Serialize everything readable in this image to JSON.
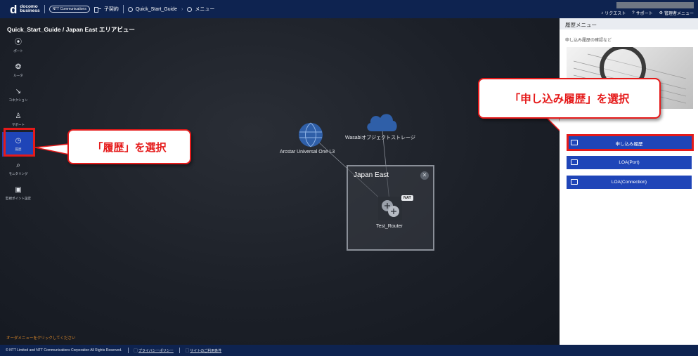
{
  "header": {
    "brand_line1": "docomo",
    "brand_line2": "business",
    "ntt_badge": "NTT Communications",
    "contract_label": "子契約",
    "crumb_project": "Quick_Start_Guide",
    "crumb_menu": "メニュー",
    "link_request": "リクエスト",
    "link_support": "サポート",
    "link_admin": "管理者メニュー"
  },
  "canvas": {
    "area_title": "Quick_Start_Guide / Japan East エリアビュー",
    "hint": "オーダメニューをクリックしてください"
  },
  "sidenav": {
    "items": [
      {
        "label": "ポート",
        "icon": "port-icon"
      },
      {
        "label": "ルータ",
        "icon": "router-icon"
      },
      {
        "label": "コネクション",
        "icon": "connection-icon"
      },
      {
        "label": "サポート",
        "icon": "support-icon"
      },
      {
        "label": "履歴",
        "icon": "history-icon"
      },
      {
        "label": "モニタリング",
        "icon": "monitoring-icon"
      },
      {
        "label": "監視ポイント設定",
        "icon": "monitor-point-icon"
      }
    ],
    "active_index": 4
  },
  "callouts": {
    "left": "「履歴」を選択",
    "right": "「申し込み履歴」を選択"
  },
  "nodes": {
    "arcstar": "Arcstar Universal One L3",
    "wasabi": "Wasabiオブジェクトストレージ",
    "region": "Japan East",
    "router": "Test_Router",
    "nat": "NAT"
  },
  "panel": {
    "title": "履歴メニュー",
    "subtitle": "申し込み履歴の確認など",
    "buttons": [
      {
        "label": "申し込み履歴",
        "icon": "history-list-icon"
      },
      {
        "label": "LOA(Port)",
        "icon": "envelope-icon"
      },
      {
        "label": "LOA(Connection)",
        "icon": "envelope-icon"
      }
    ]
  },
  "footer": {
    "copyright": "© NTT Limited and NTT Communications Corporation All Rights Reserved.",
    "privacy": "プライバシーポリシー",
    "terms": "サイトのご利用条件"
  },
  "colors": {
    "header_bg": "#0e2350",
    "accent_blue": "#1f45b8",
    "callout_red": "#e51a1a",
    "hint_orange": "#e08a2a"
  }
}
